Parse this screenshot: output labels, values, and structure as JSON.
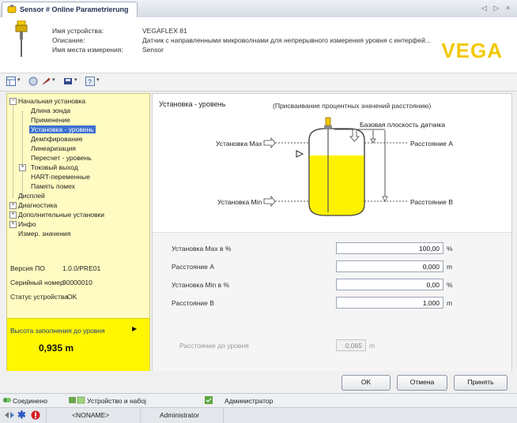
{
  "window": {
    "tab_title": "Sensor # Online Parametrierung",
    "controls": "◁ ▷ ×"
  },
  "header": {
    "device_name_label": "Имя устройства:",
    "device_name": "VEGAFLEX 81",
    "description_label": "Описание:",
    "description": "Датчик с направленными микроволнами для непрерывного измерения уровня с интерфей...",
    "location_label": "Имя места измерения:",
    "location": "Sensor",
    "logo": "VEGA"
  },
  "toolbar": {
    "icons": [
      "table-icon",
      "dropdown-arrow-icon",
      "wrench-icon",
      "dropdown-arrow-icon",
      "device-icon",
      "dropdown-arrow-icon",
      "help-icon",
      "dropdown-arrow-icon"
    ]
  },
  "sidebar": {
    "tree": [
      {
        "label": "Начальная установка",
        "level": 0,
        "toggle": "−"
      },
      {
        "label": "Длина зонда",
        "level": 1
      },
      {
        "label": "Применение",
        "level": 1
      },
      {
        "label": "Установка - уровень",
        "level": 1,
        "selected": true
      },
      {
        "label": "Демпфирование",
        "level": 1
      },
      {
        "label": "Линеаризация",
        "level": 1
      },
      {
        "label": "Пересчет - уровень",
        "level": 1
      },
      {
        "label": "Токовый выход",
        "level": 1,
        "toggle": "+"
      },
      {
        "label": "HART-переменные",
        "level": 1
      },
      {
        "label": "Память помех",
        "level": 1
      },
      {
        "label": "Дисплей",
        "level": 0
      },
      {
        "label": "Диагностика",
        "level": 0,
        "toggle": "+"
      },
      {
        "label": "Дополнительные установки",
        "level": 0,
        "toggle": "+"
      },
      {
        "label": "Инфо",
        "level": 0,
        "toggle": "+"
      },
      {
        "label": "Измер. значения",
        "level": 0
      }
    ],
    "sw_version_label": "Версия ПО",
    "sw_version": "1.0.0/PRE01",
    "serial_label": "Серийный номер",
    "serial": "90000010",
    "status_label": "Статус устройства",
    "status": "OK",
    "fill_label": "Высота заполнения до уровня",
    "fill_value": "0,935 m"
  },
  "main": {
    "title": "Установка - уровень",
    "subtitle": "(Присваивание процентных значений расстоянию)",
    "diagram": {
      "sensor_ref": "Базовая плоскость датчика",
      "max_label": "Установка Max",
      "min_label": "Установка Min",
      "dist_a": "Расстояние A",
      "dist_b": "Расстояние B"
    },
    "fields": [
      {
        "label": "Установка Max в %",
        "value": "100,00",
        "unit": "%"
      },
      {
        "label": "Расстояние A",
        "value": "0,000",
        "unit": "m"
      },
      {
        "label": "Установка Min в %",
        "value": "0,00",
        "unit": "%"
      },
      {
        "label": "Расстояние B",
        "value": "1,000",
        "unit": "m"
      }
    ],
    "distance_label": "Расстояние до уровня",
    "distance_value": "0,065",
    "distance_unit": "m"
  },
  "buttons": {
    "ok": "OK",
    "cancel": "Отмена",
    "apply": "Принять"
  },
  "statusbar": {
    "connected": "Соединено",
    "device_set": "Устройство и набој",
    "admin": "Администратор",
    "noname": "<NONAME>",
    "user": "Administrator"
  },
  "colors": {
    "accent_yellow": "#fff600",
    "sidebar_bg": "#fffbc2",
    "selection": "#3b6fd0",
    "logo": "#f2c800"
  }
}
